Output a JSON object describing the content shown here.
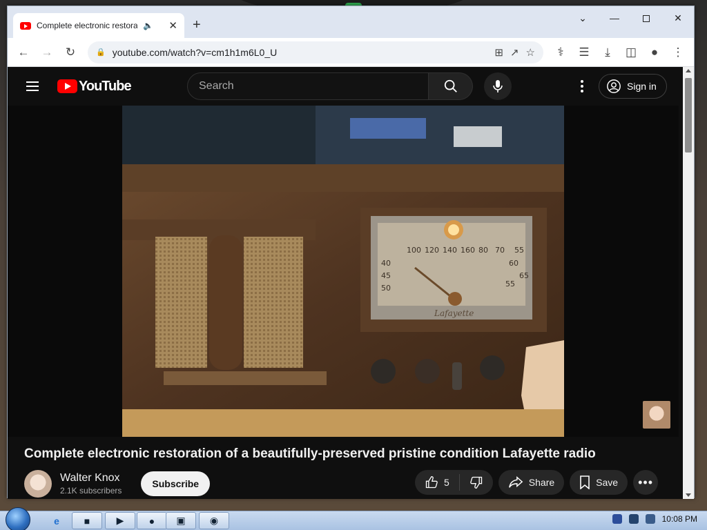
{
  "browser": {
    "tab_title": "Complete electronic restora",
    "new_tab_icon": "+",
    "url": "youtube.com/watch?v=cm1h1m6L0_U"
  },
  "youtube": {
    "logo_text": "YouTube",
    "search_placeholder": "Search",
    "sign_in_label": "Sign in"
  },
  "video": {
    "title": "Complete electronic restoration of a beautifully-preserved pristine condition Lafayette radio",
    "dial_brand": "Lafayette",
    "dial_numbers": [
      "100",
      "120",
      "140",
      "160",
      "80",
      "70",
      "55",
      "60",
      "65",
      "40",
      "45",
      "50",
      "55"
    ]
  },
  "channel": {
    "name": "Walter Knox",
    "subscribers": "2.1K subscribers",
    "subscribe_label": "Subscribe"
  },
  "actions": {
    "like_count": "5",
    "share_label": "Share",
    "save_label": "Save"
  },
  "taskbar": {
    "clock": "10:08 PM"
  },
  "colors": {
    "yt_red": "#ff0000",
    "page_bg": "#0f0f0f",
    "subscribe_bg": "#f1f1f1"
  }
}
